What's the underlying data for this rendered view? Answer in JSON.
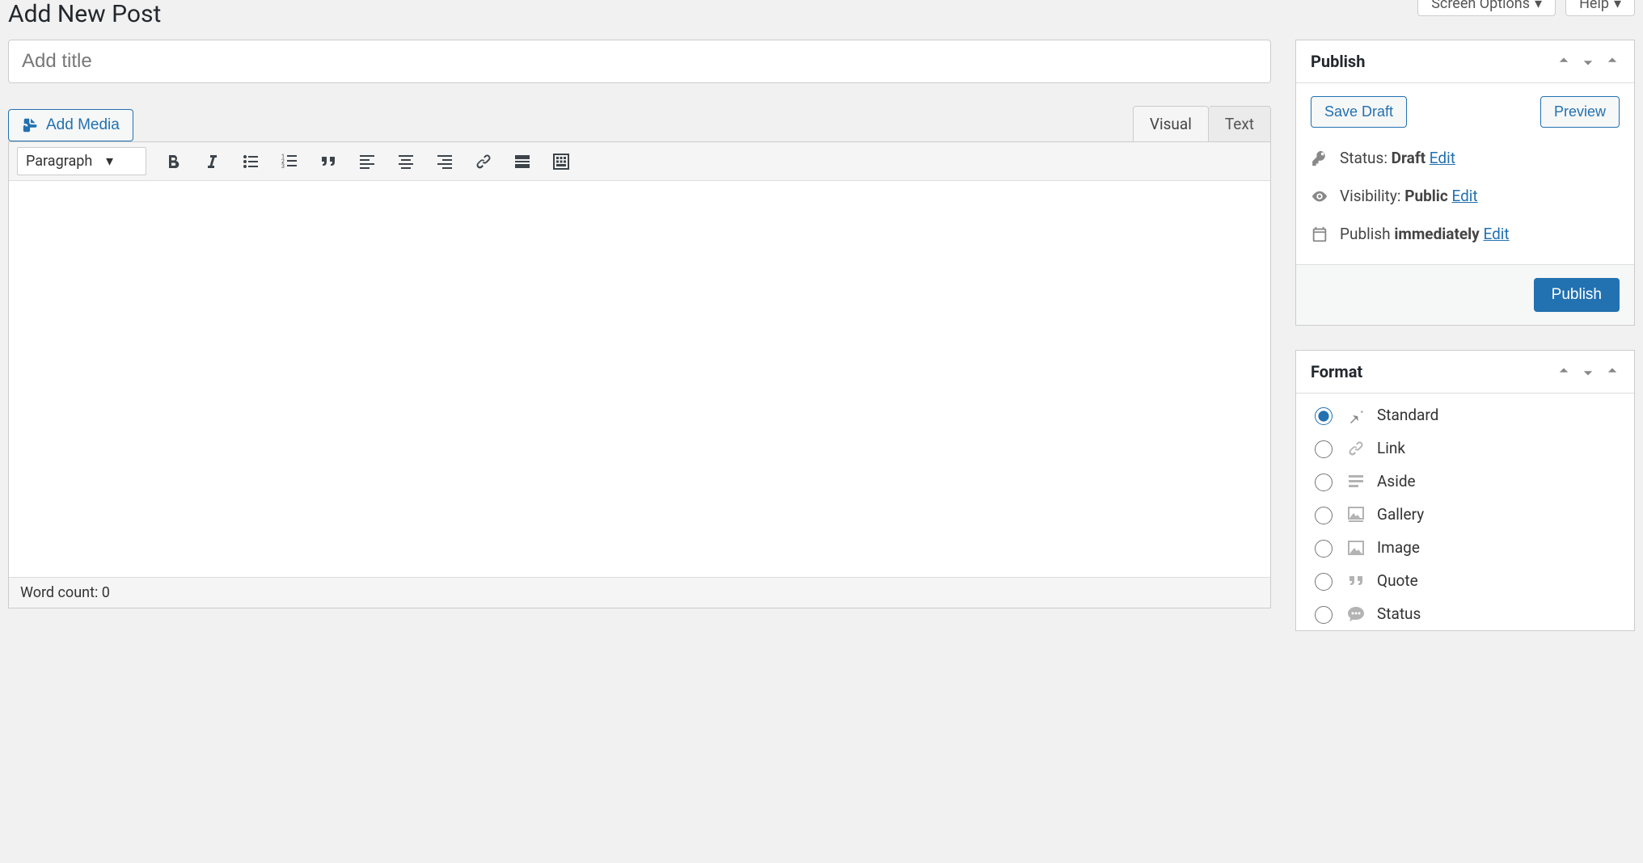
{
  "topButtons": {
    "screenOptions": "Screen Options",
    "help": "Help"
  },
  "page": {
    "heading": "Add New Post",
    "titlePlaceholder": "Add title"
  },
  "addMedia": "Add Media",
  "tabs": {
    "visual": "Visual",
    "text": "Text"
  },
  "paragraphSelect": "Paragraph",
  "wordCount": {
    "label": "Word count: ",
    "value": "0"
  },
  "publishBox": {
    "title": "Publish",
    "saveDraft": "Save Draft",
    "preview": "Preview",
    "statusLabel": "Status: ",
    "statusValue": "Draft",
    "visibilityLabel": "Visibility: ",
    "visibilityValue": "Public",
    "schedulePrefix": "Publish ",
    "scheduleValue": "immediately",
    "edit": "Edit",
    "publishBtn": "Publish"
  },
  "formatBox": {
    "title": "Format",
    "options": [
      {
        "label": "Standard",
        "checked": true
      },
      {
        "label": "Link",
        "checked": false
      },
      {
        "label": "Aside",
        "checked": false
      },
      {
        "label": "Gallery",
        "checked": false
      },
      {
        "label": "Image",
        "checked": false
      },
      {
        "label": "Quote",
        "checked": false
      },
      {
        "label": "Status",
        "checked": false
      }
    ]
  }
}
